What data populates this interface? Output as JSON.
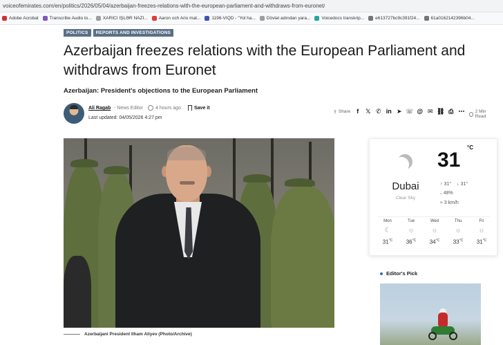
{
  "browser": {
    "url": "voiceofemirates.com/en/politics/2026/05/04/azerbaijan-freezes-relations-with-the-european-parliament-and-withdraws-from-euronet/",
    "bookmarks": [
      {
        "label": "Adobe Acrobat",
        "color": "#d32f2f"
      },
      {
        "label": "Transcribe Audio to...",
        "color": "#7e57c2"
      },
      {
        "label": "XARICI İŞLƏR NAZİ...",
        "color": "#9e9e9e"
      },
      {
        "label": "Aaron och Ario mat...",
        "color": "#e53935"
      },
      {
        "label": "1196-VIQD - \"Yol ha...",
        "color": "#3f51b5"
      },
      {
        "label": "Dövlət adından yara...",
        "color": "#9e9e9e"
      },
      {
        "label": "Voicedocs transkrip...",
        "color": "#26a69a"
      },
      {
        "label": "e613727bc9c391f24...",
        "color": "#757575"
      },
      {
        "label": "61a0162142396b04...",
        "color": "#757575"
      }
    ]
  },
  "article": {
    "tags": [
      "POLITICS",
      "REPORTS AND INVESTIGATIONS"
    ],
    "headline": "Azerbaijan freezes relations with the European Parliament and withdraws from Euronet",
    "subheadline": "Azerbaijan: President's objections to the European Parliament",
    "author": {
      "name": "Ali Ragab",
      "role": "- News Editor",
      "time_ago": "4 hours ago",
      "save_label": "Save it",
      "last_updated": "Last updated: 04/05/2026 4:27 pm"
    },
    "share": {
      "label": "Share",
      "icons": [
        {
          "name": "facebook-icon",
          "glyph": "f"
        },
        {
          "name": "x-icon",
          "glyph": "𝕏"
        },
        {
          "name": "whatsapp-icon",
          "glyph": "✆"
        },
        {
          "name": "linkedin-icon",
          "glyph": "in"
        },
        {
          "name": "telegram-icon",
          "glyph": "➤"
        },
        {
          "name": "viber-icon",
          "glyph": "☏"
        },
        {
          "name": "threads-icon",
          "glyph": "@"
        },
        {
          "name": "email-icon",
          "glyph": "✉"
        },
        {
          "name": "link-icon",
          "glyph": "⛓"
        },
        {
          "name": "print-icon",
          "glyph": "⎙"
        },
        {
          "name": "more-icon",
          "glyph": "⋯"
        }
      ]
    },
    "read_time": "2 Min Read",
    "image_caption": "Azerbaijani President Ilham Aliyev (Photo/Archive)"
  },
  "weather": {
    "icon": "moon-icon",
    "temperature": "31",
    "unit": "°C",
    "city": "Dubai",
    "condition": "Clear Sky",
    "high": "↑ 31°",
    "low": "↓ 31°",
    "humidity": "48%",
    "wind": "3 km/h",
    "forecast": [
      {
        "day": "Mon",
        "icon": "moon-icon",
        "temp": "31"
      },
      {
        "day": "Tue",
        "icon": "sun-icon",
        "temp": "36"
      },
      {
        "day": "Wed",
        "icon": "sun-icon",
        "temp": "34"
      },
      {
        "day": "Thu",
        "icon": "sun-icon",
        "temp": "33"
      },
      {
        "day": "Fri",
        "icon": "sun-icon",
        "temp": "31"
      }
    ]
  },
  "sidebar": {
    "editors_pick_title": "Editor's Pick"
  }
}
